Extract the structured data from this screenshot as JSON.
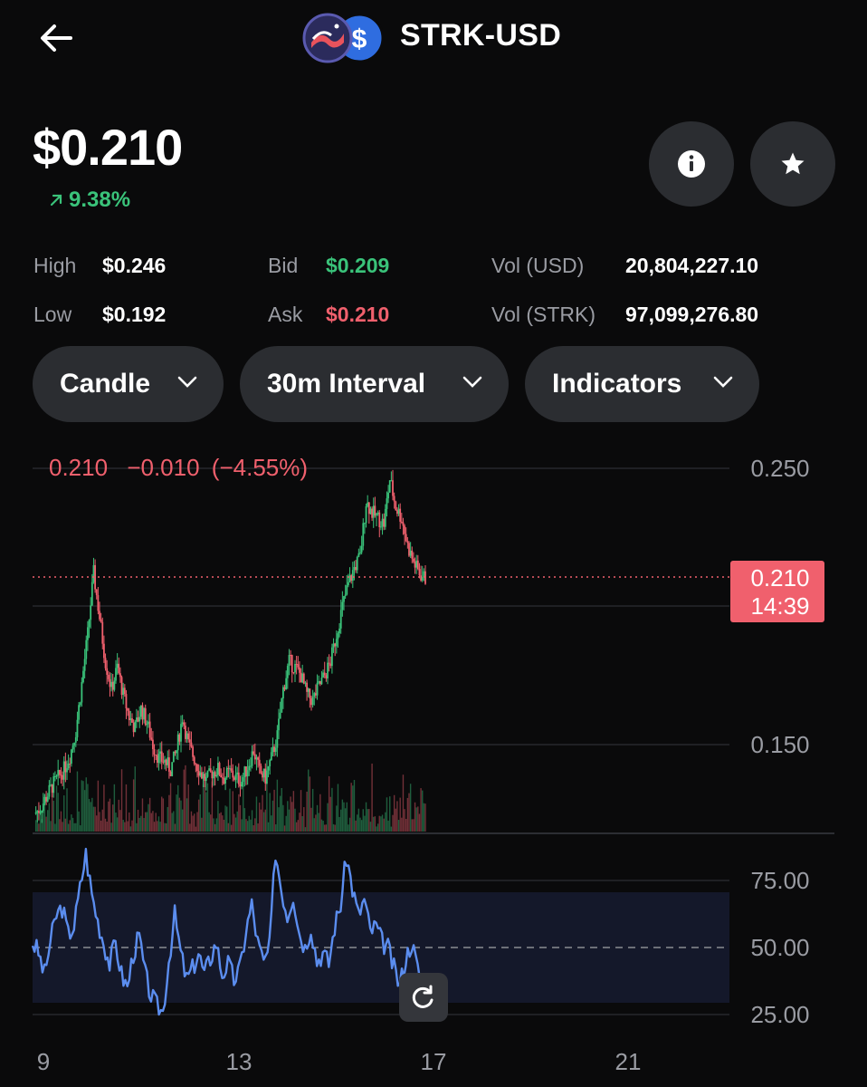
{
  "header": {
    "pair": "STRK-USD"
  },
  "ticker": {
    "price": "$0.210",
    "change": "9.38%",
    "stats": {
      "high_label": "High",
      "high_value": "$0.246",
      "low_label": "Low",
      "low_value": "$0.192",
      "bid_label": "Bid",
      "bid_value": "$0.209",
      "ask_label": "Ask",
      "ask_value": "$0.210",
      "vol_usd_label": "Vol (USD)",
      "vol_usd_value": "20,804,227.10",
      "vol_strk_label": "Vol (STRK)",
      "vol_strk_value": "97,099,276.80"
    }
  },
  "controls": {
    "chart_type": "Candle",
    "interval": "30m Interval",
    "indicators": "Indicators"
  },
  "icons": {
    "back": "arrow-left-icon",
    "info": "info-icon",
    "star": "star-icon",
    "reset": "reset-icon",
    "chevron": "chevron-down-icon"
  },
  "colors": {
    "up": "#3ac37a",
    "down": "#f0606d",
    "rsi_line": "#5b8def",
    "price_tag_bg": "#f0606d"
  },
  "chart_data": {
    "type": "candlestick",
    "price_panel": {
      "legend": {
        "close": "0.210",
        "change": "−0.010",
        "change_pct": "(−4.55%)"
      },
      "y_ticks": [
        "0.250",
        "0.150"
      ],
      "y_range": [
        0.115,
        0.255
      ],
      "current_price_tag": "0.210",
      "countdown": "14:39",
      "close_series": [
        0.125,
        0.127,
        0.131,
        0.135,
        0.138,
        0.141,
        0.146,
        0.155,
        0.172,
        0.19,
        0.212,
        0.196,
        0.18,
        0.17,
        0.178,
        0.168,
        0.16,
        0.156,
        0.163,
        0.158,
        0.15,
        0.145,
        0.144,
        0.141,
        0.148,
        0.16,
        0.15,
        0.145,
        0.14,
        0.137,
        0.14,
        0.141,
        0.138,
        0.14,
        0.138,
        0.137,
        0.142,
        0.148,
        0.14,
        0.138,
        0.145,
        0.153,
        0.17,
        0.18,
        0.178,
        0.175,
        0.168,
        0.166,
        0.171,
        0.175,
        0.18,
        0.19,
        0.2,
        0.208,
        0.214,
        0.218,
        0.238,
        0.234,
        0.232,
        0.23,
        0.246,
        0.236,
        0.232,
        0.222,
        0.216,
        0.212,
        0.21
      ]
    },
    "rsi_panel": {
      "y_ticks": [
        "75.00",
        "50.00",
        "25.00"
      ],
      "y_range": [
        20,
        90
      ],
      "band": [
        30,
        70
      ],
      "midline": 50,
      "values": [
        52,
        48,
        40,
        52,
        62,
        65,
        55,
        58,
        72,
        85,
        70,
        60,
        52,
        44,
        52,
        40,
        35,
        48,
        54,
        40,
        32,
        28,
        26,
        45,
        62,
        48,
        38,
        42,
        48,
        40,
        46,
        52,
        40,
        44,
        38,
        42,
        56,
        66,
        52,
        44,
        50,
        86,
        72,
        62,
        70,
        56,
        50,
        58,
        45,
        48,
        44,
        58,
        66,
        84,
        72,
        62,
        68,
        56,
        58,
        52,
        50,
        42,
        36,
        46,
        52,
        42,
        35
      ]
    },
    "x_ticks": [
      "9",
      "13",
      "17",
      "21"
    ]
  }
}
